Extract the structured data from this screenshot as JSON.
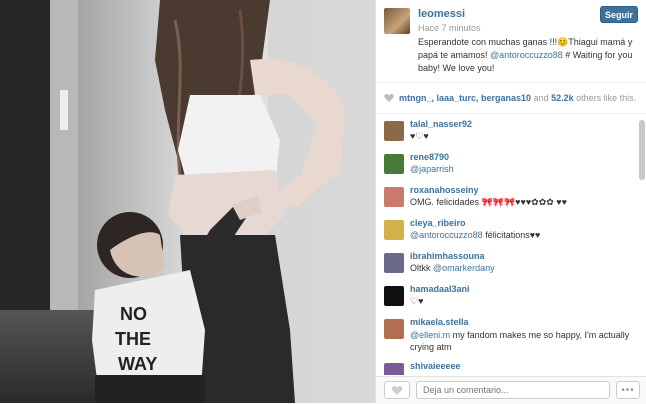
{
  "post": {
    "photo_alt": "black and white photo",
    "username": "leomessi",
    "time": "Hace 7 minutos",
    "caption_text": "Esperandote con muchas ganas !!!😊Thiagui mamá y papá te amamos! ",
    "caption_mention": "@antoroccuzzo88",
    "caption_text2": " # Waiting for you baby! We love you!",
    "follow_label": "Seguir"
  },
  "likes": {
    "names": "mtngn_, laaa_turc, berganas10",
    "and": " and ",
    "count": "52.2k",
    "suffix": " others like this."
  },
  "comments": [
    {
      "user": "talal_nasser92",
      "text": "♥♡♥",
      "avatar_color": "#8b6a4a"
    },
    {
      "user": "rene8790",
      "text": "@japarrish",
      "mention": true,
      "avatar_color": "#4a7a3a"
    },
    {
      "user": "roxanahosseiny",
      "text": "OMG. felicidades 🎀🎀🎀♥♥♥✿✿✿ ♥♥",
      "avatar_color": "#c97a6a"
    },
    {
      "user": "cleya_ribeiro",
      "mention_text": "@antoroccuzzo88",
      "text": " félicitations♥♥",
      "avatar_color": "#d4b04a"
    },
    {
      "user": "ibrahimhassouna",
      "text": "Oltkk ",
      "mention_text": "@omarkerdany",
      "avatar_color": "#6a6a8a"
    },
    {
      "user": "hamadaal3ani",
      "text": "♡♥",
      "avatar_color": "#111111"
    },
    {
      "user": "mikaela.stella",
      "mention_text": "@elleni.m",
      "text": " my fandom makes me so happy, I'm actually crying atm",
      "avatar_color": "#b07050"
    },
    {
      "user": "shivaieeeee",
      "text": "",
      "avatar_color": "#7a5a9a"
    }
  ],
  "footer": {
    "comment_placeholder": "Deja un comentario...",
    "more_label": "•••"
  }
}
